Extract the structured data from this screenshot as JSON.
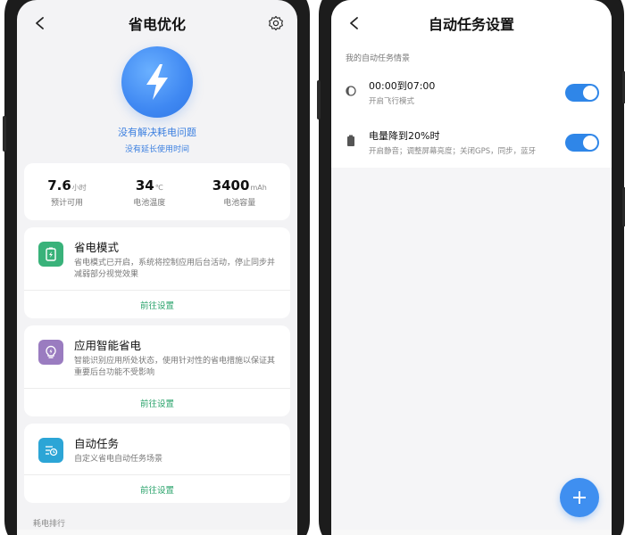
{
  "left": {
    "header": {
      "title": "省电优化"
    },
    "hero": {
      "link": "没有解决耗电问题",
      "sub": "没有延长使用时间"
    },
    "stats": [
      {
        "value": "7.6",
        "unit": "小时",
        "label": "预计可用"
      },
      {
        "value": "34",
        "unit": "℃",
        "label": "电池温度"
      },
      {
        "value": "3400",
        "unit": "mAh",
        "label": "电池容量"
      }
    ],
    "cards": [
      {
        "title": "省电模式",
        "desc": "省电模式已开启，系统将控制应用后台活动，停止同步并减弱部分视觉效果",
        "action": "前往设置",
        "icon_color": "#39b27a"
      },
      {
        "title": "应用智能省电",
        "desc": "智能识别应用所处状态，使用针对性的省电措施以保证其重要后台功能不受影响",
        "action": "前往设置",
        "icon_color": "#9a7cc0"
      },
      {
        "title": "自动任务",
        "desc": "自定义省电自动任务场景",
        "action": "前往设置",
        "icon_color": "#2ca5d6"
      }
    ],
    "cut_label": "耗电排行"
  },
  "right": {
    "header": {
      "title": "自动任务设置"
    },
    "section_label": "我的自动任务情景",
    "tasks": [
      {
        "title": "00:00到07:00",
        "sub": "开启飞行模式",
        "icon": "moon-clock-icon",
        "enabled": true
      },
      {
        "title": "电量降到20%时",
        "sub": "开启静音；调整屏幕亮度；关闭GPS，同步，蓝牙",
        "icon": "battery-icon",
        "enabled": true
      }
    ]
  },
  "colors": {
    "accent_blue": "#3f8ff0",
    "action_green": "#2aa36b",
    "toggle_blue": "#2f86e8"
  }
}
